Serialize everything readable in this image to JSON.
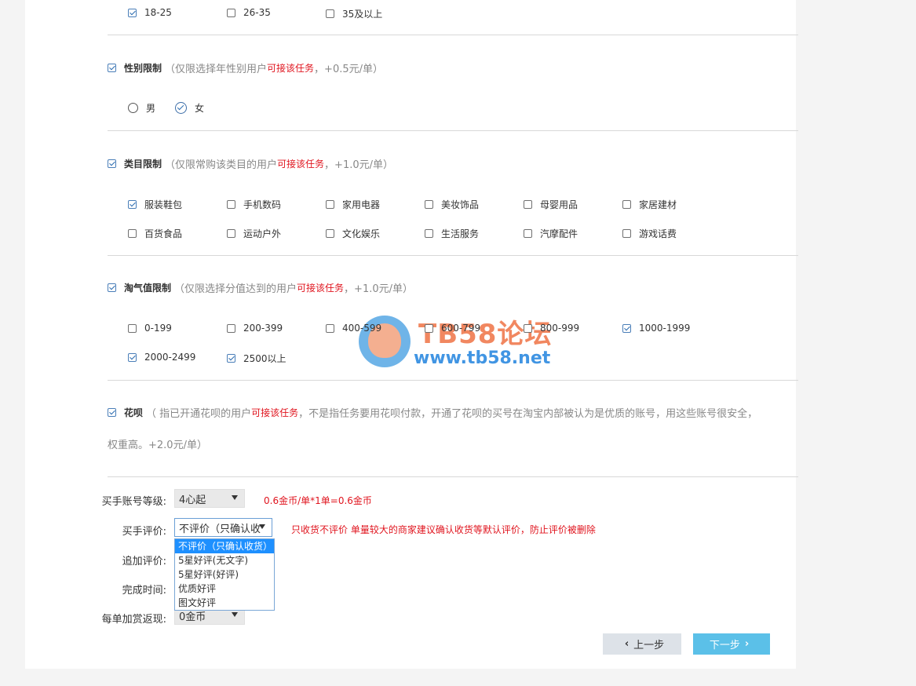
{
  "age": {
    "options": [
      {
        "label": "18-25",
        "checked": true
      },
      {
        "label": "26-35",
        "checked": false
      },
      {
        "label": "35及以上",
        "checked": false
      }
    ]
  },
  "gender": {
    "title": "性别限制",
    "desc_pre": "（仅限选择年性别用户 ",
    "desc_red": "可接该任务",
    "desc_post": "，+0.5元/单）",
    "checked": true,
    "options": [
      {
        "label": "男",
        "checked": false
      },
      {
        "label": "女",
        "checked": true
      }
    ]
  },
  "category": {
    "title": "类目限制",
    "desc_pre": "（仅限常购该类目的用户 ",
    "desc_red": "可接该任务",
    "desc_post": "，+1.0元/单）",
    "checked": true,
    "options": [
      {
        "label": "服装鞋包",
        "checked": true
      },
      {
        "label": "手机数码",
        "checked": false
      },
      {
        "label": "家用电器",
        "checked": false
      },
      {
        "label": "美妆饰品",
        "checked": false
      },
      {
        "label": "母婴用品",
        "checked": false
      },
      {
        "label": "家居建材",
        "checked": false
      },
      {
        "label": "百货食品",
        "checked": false
      },
      {
        "label": "运动户外",
        "checked": false
      },
      {
        "label": "文化娱乐",
        "checked": false
      },
      {
        "label": "生活服务",
        "checked": false
      },
      {
        "label": "汽摩配件",
        "checked": false
      },
      {
        "label": "游戏话费",
        "checked": false
      }
    ]
  },
  "taoqi": {
    "title": "淘气值限制",
    "desc_pre": "（仅限选择分值达到的用户",
    "desc_red": "可接该任务",
    "desc_post": "，+1.0元/单）",
    "checked": true,
    "options": [
      {
        "label": "0-199",
        "checked": false
      },
      {
        "label": "200-399",
        "checked": false
      },
      {
        "label": "400-599",
        "checked": false
      },
      {
        "label": "600-799",
        "checked": false
      },
      {
        "label": "800-999",
        "checked": false
      },
      {
        "label": "1000-1999",
        "checked": true
      },
      {
        "label": "2000-2499",
        "checked": true
      },
      {
        "label": "2500以上",
        "checked": true
      }
    ]
  },
  "huabei": {
    "title": "花呗",
    "desc_pre": "（ 指已开通花呗的用户",
    "desc_red": "可接该任务",
    "desc_post": "，不是指任务要用花呗付款，开通了花呗的买号在淘宝内部被认为是优质的账号，用这些账号很安全，",
    "desc_line2": "权重高。+2.0元/单）",
    "checked": true
  },
  "form": {
    "level_label": "买手账号等级:",
    "level_value": "4心起",
    "level_note": "0.6金币/单*1单=0.6金币",
    "review_label": "买手评价:",
    "review_value": "不评价（只确认收",
    "review_note": "只收货不评价 单量较大的商家建议确认收货等默认评价，防止评价被删除",
    "review_options": [
      "不评价（只确认收货）",
      "5星好评(无文字)",
      "5星好评(好评)",
      "优质好评",
      "图文好评"
    ],
    "extra_review_label": "追加评价:",
    "finish_time_label": "完成时间:",
    "bonus_label": "每单加赏返现:",
    "bonus_value": "0金币"
  },
  "buttons": {
    "prev": "上一步",
    "next": "下一步"
  },
  "watermark": {
    "title": "TB58论坛",
    "url": "www.tb58.net"
  }
}
